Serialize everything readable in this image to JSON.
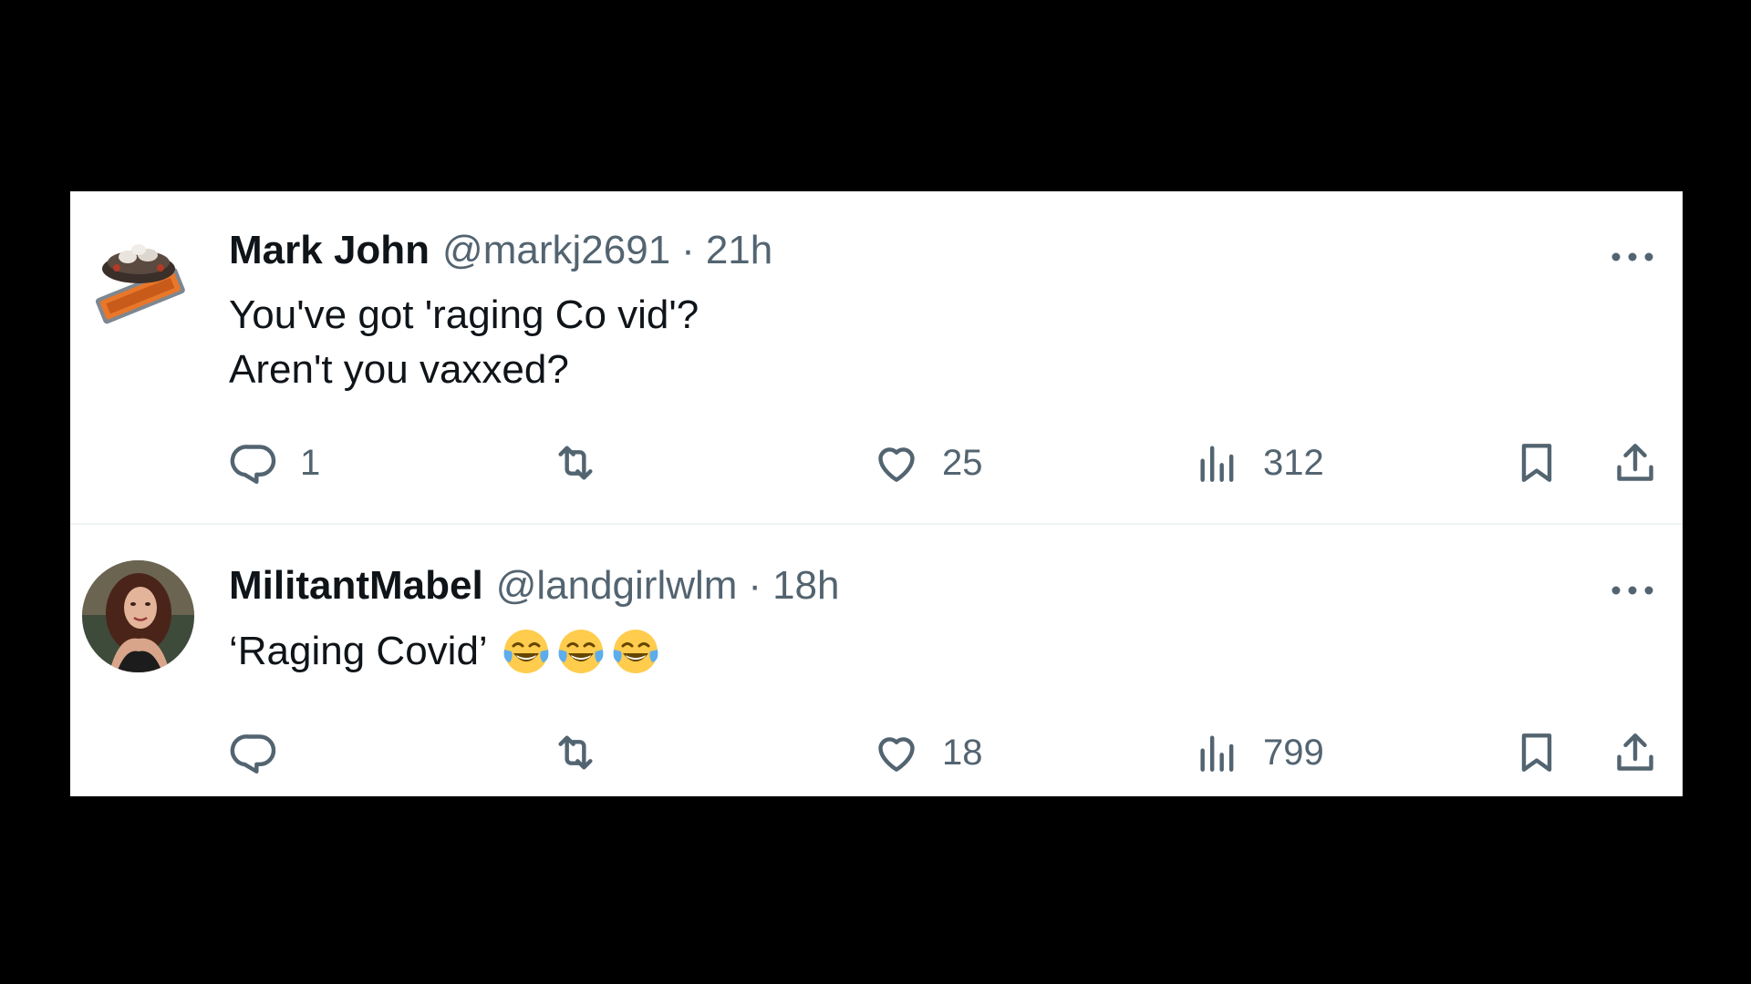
{
  "tweets": [
    {
      "author_name": "Mark John",
      "author_handle": "@markj2691",
      "separator": "·",
      "time": "21h",
      "text": "You've got 'raging Co vid'?\nAren't you vaxxed?",
      "emojis": [],
      "avatar_icon": "cake-logo-avatar",
      "metrics": {
        "replies": "1",
        "reposts": "",
        "likes": "25",
        "views": "312"
      }
    },
    {
      "author_name": "MilitantMabel",
      "author_handle": "@landgirlwlm",
      "separator": "·",
      "time": "18h",
      "text": "‘Raging Covid’",
      "emojis": [
        "tears-of-joy-emoji",
        "tears-of-joy-emoji",
        "tears-of-joy-emoji"
      ],
      "avatar_icon": "profile-photo-avatar",
      "metrics": {
        "replies": "",
        "reposts": "",
        "likes": "18",
        "views": "799"
      }
    }
  ],
  "colors": {
    "background": "#000000",
    "card": "#ffffff",
    "primary_text": "#0f1419",
    "secondary_text": "#536471",
    "divider": "#eff3f4"
  },
  "icons": {
    "reply": "reply-icon",
    "repost": "repost-icon",
    "like": "heart-icon",
    "views": "views-icon",
    "bookmark": "bookmark-icon",
    "share": "share-icon",
    "more": "more-icon"
  }
}
